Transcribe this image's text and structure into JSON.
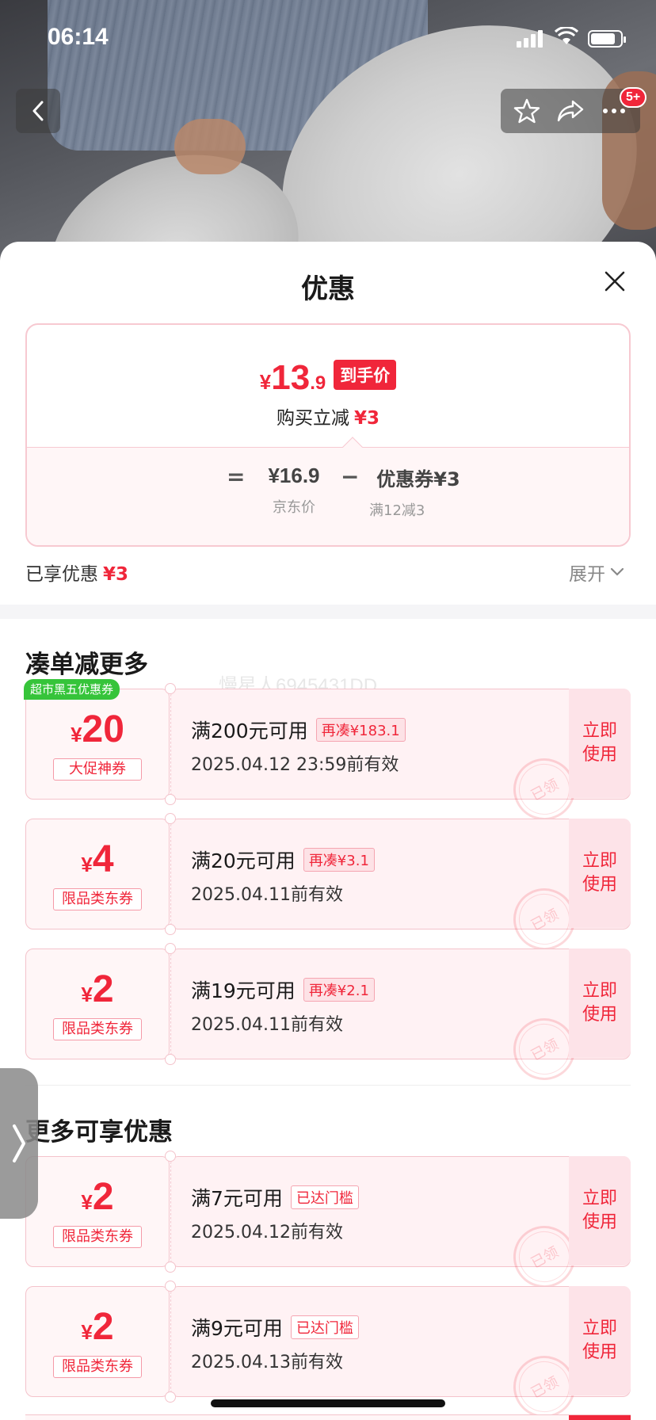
{
  "status_bar": {
    "time": "06:14"
  },
  "nav": {
    "badge": "5+"
  },
  "sheet": {
    "title": "优惠",
    "price": {
      "currency": "¥",
      "integer": "13",
      "decimal": ".9",
      "tag": "到手价",
      "discount_label": "购买立减",
      "discount_amount": "¥3",
      "formula": {
        "eq": "=",
        "jd_price": "¥16.9",
        "jd_price_label": "京东价",
        "minus": "−",
        "coupon": "优惠券¥3",
        "coupon_label": "满12减3"
      }
    },
    "enjoyed": {
      "label": "已享优惠",
      "amount": "¥3"
    },
    "expand_label": "展开",
    "section1_title": "凑单减更多",
    "section2_title": "更多可享优惠",
    "watermark": "慢星人6945431DD",
    "use_label_1": "立即",
    "use_label_2": "使用",
    "stamp_label": "已领"
  },
  "coupons": [
    {
      "promo": "超市黑五优惠券",
      "currency": "¥",
      "amount": "20",
      "type": "大促神券",
      "condition": "满200元可用",
      "tag": "再凑¥183.1",
      "valid": "2025.04.12 23:59前有效"
    },
    {
      "currency": "¥",
      "amount": "4",
      "type": "限品类东券",
      "condition": "满20元可用",
      "tag": "再凑¥3.1",
      "valid": "2025.04.11前有效"
    },
    {
      "currency": "¥",
      "amount": "2",
      "type": "限品类东券",
      "condition": "满19元可用",
      "tag": "再凑¥2.1",
      "valid": "2025.04.11前有效"
    },
    {
      "currency": "¥",
      "amount": "2",
      "type": "限品类东券",
      "condition": "满7元可用",
      "tag": "已达门槛",
      "valid": "2025.04.12前有效"
    },
    {
      "currency": "¥",
      "amount": "2",
      "type": "限品类东券",
      "condition": "满9元可用",
      "tag": "已达门槛",
      "valid": "2025.04.13前有效"
    }
  ],
  "colors": {
    "accent": "#f0263a",
    "promo_green": "#36c43a"
  },
  "icons": [
    "back-icon",
    "star-icon",
    "share-icon",
    "more-icon",
    "close-icon",
    "chevron-down-icon",
    "chevron-right-icon"
  ]
}
